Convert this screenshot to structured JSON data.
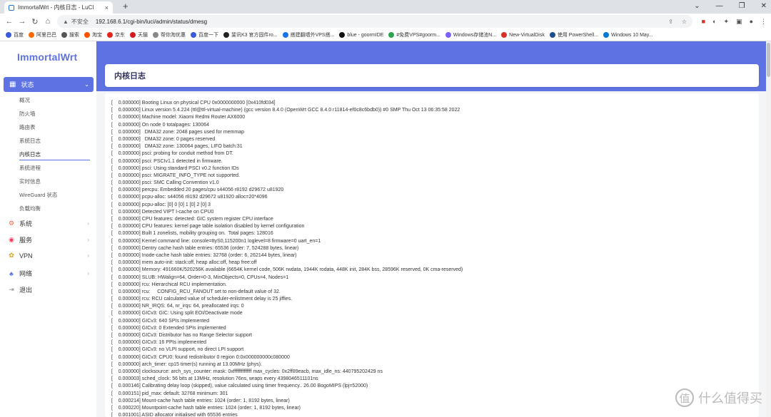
{
  "browser": {
    "tab_title": "ImmortalWrt - 内核日志 - LuCI",
    "tab_close": "×",
    "new_tab": "+",
    "security_label": "不安全",
    "url": "192.168.6.1/cgi-bin/luci/admin/status/dmesg",
    "window_controls": [
      "⌄",
      "—",
      "❐",
      "✕"
    ]
  },
  "bookmarks": [
    {
      "label": "百度",
      "color": "#3b5bdb"
    },
    {
      "label": "阿里巴巴",
      "color": "#ff6a00"
    },
    {
      "label": "搜索",
      "color": "#555"
    },
    {
      "label": "淘宝",
      "color": "#ff5000"
    },
    {
      "label": "京东",
      "color": "#e1251b"
    },
    {
      "label": "天猫",
      "color": "#d71921"
    },
    {
      "label": "帮你淘优惠",
      "color": "#888"
    },
    {
      "label": "百度一下",
      "color": "#3b5bdb"
    },
    {
      "label": "斐讯K3 官方固件ro...",
      "color": "#222"
    },
    {
      "label": "搭建翻墙外VPS搭...",
      "color": "#1a73e8"
    },
    {
      "label": "blue - goormIDE",
      "color": "#111"
    },
    {
      "label": "#免费VPS#goorm...",
      "color": "#2da44e"
    },
    {
      "label": "Windows存储池N...",
      "color": "#7b61ff"
    },
    {
      "label": "New-VirtualDisk",
      "color": "#d93025"
    },
    {
      "label": "使用 PowerShell...",
      "color": "#1f4e8c"
    },
    {
      "label": "Windows 10 May...",
      "color": "#0078d4"
    }
  ],
  "app": {
    "logo": "ImmortalWrt",
    "page_title": "内核日志",
    "nav": {
      "status": {
        "label": "状态",
        "subitems": [
          "概况",
          "防火墙",
          "路由表",
          "系统日志",
          "内核日志",
          "系统进程",
          "实时信息",
          "WireGuard 状态",
          "负载均衡"
        ],
        "active_index": 4
      },
      "items": [
        {
          "label": "系统",
          "icon": "gear-icon",
          "glyph": "⚙",
          "color": "#fb6340",
          "chevron": "›"
        },
        {
          "label": "服务",
          "icon": "services-icon",
          "glyph": "◉",
          "color": "#f5365c",
          "chevron": "›"
        },
        {
          "label": "VPN",
          "icon": "vpn-icon",
          "glyph": "✿",
          "color": "#d4a017",
          "chevron": "›"
        },
        {
          "label": "网络",
          "icon": "network-icon",
          "glyph": "♣",
          "color": "#5e72e4",
          "chevron": "›"
        },
        {
          "label": "退出",
          "icon": "logout-icon",
          "glyph": "⇥",
          "color": "#888",
          "chevron": ""
        }
      ]
    }
  },
  "log_lines": [
    "[    0.000000] Booting Linux on physical CPU 0x0000000000 [0x410fd034]",
    "[    0.000000] Linux version 5.4.224 (ttl@ttl-virtual-machine) (gcc version 8.4.0 (OpenWrt GCC 8.4.0 r11814-ef0c8c6bdb0)) #0 SMP Thu Oct 13 06:35:58 2022",
    "[    0.000000] Machine model: Xiaomi Redmi Router AX6000",
    "[    0.000000] On node 0 totalpages: 130064",
    "[    0.000000]   DMA32 zone: 2048 pages used for memmap",
    "[    0.000000]   DMA32 zone: 0 pages reserved",
    "[    0.000000]   DMA32 zone: 130064 pages, LIFO batch:31",
    "[    0.000000] psci: probing for conduit method from DT.",
    "[    0.000000] psci: PSCIv1.1 detected in firmware.",
    "[    0.000000] psci: Using standard PSCI v0.2 function IDs",
    "[    0.000000] psci: MIGRATE_INFO_TYPE not supported.",
    "[    0.000000] psci: SMC Calling Convention v1.0",
    "[    0.000000] percpu: Embedded 20 pages/cpu s44056 r8192 d29672 u81920",
    "[    0.000000] pcpu-alloc: s44056 r8192 d29672 u81920 alloc=20*4096",
    "[    0.000000] pcpu-alloc: [0] 0 [0] 1 [0] 2 [0] 3",
    "[    0.000000] Detected VIPT I-cache on CPU0",
    "[    0.000000] CPU features: detected: GIC system register CPU interface",
    "[    0.000000] CPU features: kernel page table isolation disabled by kernel configuration",
    "[    0.000000] Built 1 zonelists, mobility grouping on.  Total pages: 128016",
    "[    0.000000] Kernel command line: console=ttyS0,115200n1 loglevel=8 firmware=0 uart_en=1",
    "[    0.000000] Dentry cache hash table entries: 65536 (order: 7, 524288 bytes, linear)",
    "[    0.000000] Inode-cache hash table entries: 32768 (order: 6, 262144 bytes, linear)",
    "[    0.000000] mem auto-init: stack:off, heap alloc:off, heap free:off",
    "[    0.000000] Memory: 491660K/520256K available (6654K kernel code, 506K rwdata, 1944K rodata, 448K init, 284K bss, 28596K reserved, 0K cma-reserved)",
    "[    0.000000] SLUB: HWalign=64, Order=0-3, MinObjects=0, CPUs=4, Nodes=1",
    "[    0.000000] rcu: Hierarchical RCU implementation.",
    "[    0.000000] rcu:     CONFIG_RCU_FANOUT set to non-default value of 32.",
    "[    0.000000] rcu: RCU calculated value of scheduler-enlistment delay is 25 jiffies.",
    "[    0.000000] NR_IRQS: 64, nr_irqs: 64, preallocated irqs: 0",
    "[    0.000000] GICv3: GIC: Using split EOI/Deactivate mode",
    "[    0.000000] GICv3: 640 SPIs implemented",
    "[    0.000000] GICv3: 0 Extended SPIs implemented",
    "[    0.000000] GICv3: Distributor has no Range Selector support",
    "[    0.000000] GICv3: 16 PPIs implemented",
    "[    0.000000] GICv3: no VLPI support, no direct LPI support",
    "[    0.000000] GICv3: CPU0: found redistributor 0 region 0:0x000000000c080000",
    "[    0.000000] arch_timer: cp15 timer(s) running at 13.00MHz (phys).",
    "[    0.000000] clocksource: arch_sys_counter: mask: 0xffffffffffffff max_cycles: 0x2ff89eacb, max_idle_ns: 440795202429 ns",
    "[    0.000003] sched_clock: 56 bits at 13MHz, resolution 76ns, wraps every 4398046511101ns",
    "[    0.000146] Calibrating delay loop (skipped), value calculated using timer frequency.. 26.00 BogoMIPS (lpj=52000)",
    "[    0.000151] pid_max: default: 32768 minimum: 301",
    "[    0.000214] Mount-cache hash table entries: 1024 (order: 1, 8192 bytes, linear)",
    "[    0.000220] Mountpoint-cache hash table entries: 1024 (order: 1, 8192 bytes, linear)",
    "[    0.001001] ASID allocator initialised with 65536 entries"
  ],
  "watermark": {
    "badge": "值",
    "text": "什么值得买"
  }
}
